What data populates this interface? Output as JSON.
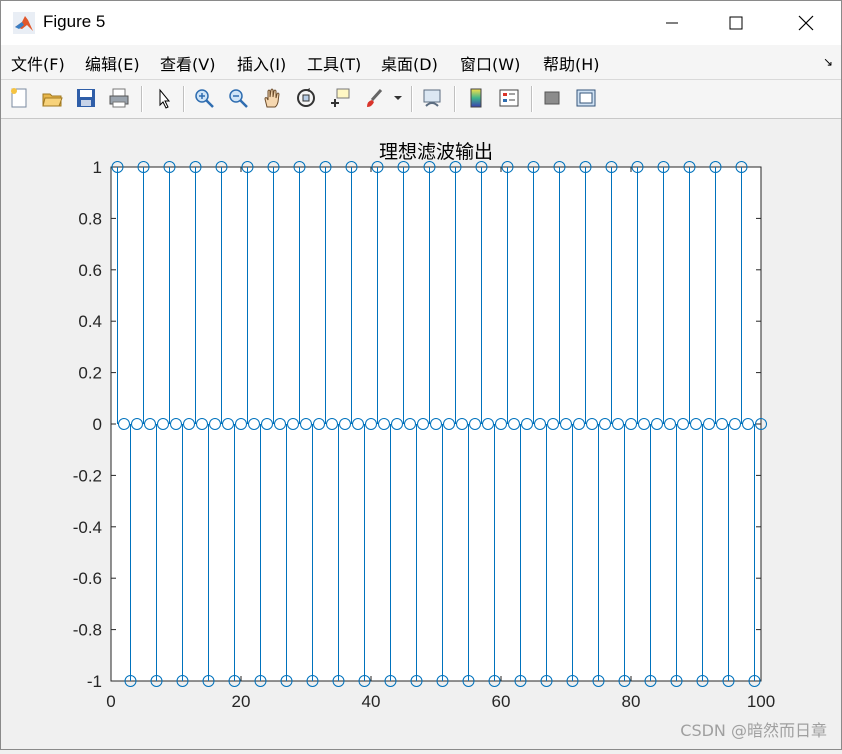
{
  "window": {
    "title": "Figure 5"
  },
  "menu": [
    "文件(F)",
    "编辑(E)",
    "查看(V)",
    "插入(I)",
    "工具(T)",
    "桌面(D)",
    "窗口(W)",
    "帮助(H)"
  ],
  "toolbar": [
    "new-figure-icon",
    "open-file-icon",
    "save-icon",
    "print-icon",
    "pointer-icon",
    "zoom-in-icon",
    "zoom-out-icon",
    "pan-hand-icon",
    "rotate-3d-icon",
    "data-cursor-icon",
    "brush-icon",
    "brush-dropdown-icon",
    "link-plot-icon",
    "colorbar-icon",
    "legend-icon",
    "hide-plot-tools-icon",
    "show-plot-tools-icon"
  ],
  "watermark": "CSDN @暗然而日章",
  "chart_data": {
    "type": "stem",
    "title": "理想滤波输出",
    "xlabel": "",
    "ylabel": "",
    "xlim": [
      0,
      100
    ],
    "ylim": [
      -1,
      1
    ],
    "xticks": [
      "0",
      "20",
      "40",
      "60",
      "80",
      "100"
    ],
    "yticks": [
      "-1",
      "-0.8",
      "-0.6",
      "-0.4",
      "-0.2",
      "0",
      "0.2",
      "0.4",
      "0.6",
      "0.8",
      "1"
    ],
    "color": "#0072bd",
    "x": [
      1,
      2,
      3,
      4,
      5,
      6,
      7,
      8,
      9,
      10,
      11,
      12,
      13,
      14,
      15,
      16,
      17,
      18,
      19,
      20,
      21,
      22,
      23,
      24,
      25,
      26,
      27,
      28,
      29,
      30,
      31,
      32,
      33,
      34,
      35,
      36,
      37,
      38,
      39,
      40,
      41,
      42,
      43,
      44,
      45,
      46,
      47,
      48,
      49,
      50,
      51,
      52,
      53,
      54,
      55,
      56,
      57,
      58,
      59,
      60,
      61,
      62,
      63,
      64,
      65,
      66,
      67,
      68,
      69,
      70,
      71,
      72,
      73,
      74,
      75,
      76,
      77,
      78,
      79,
      80,
      81,
      82,
      83,
      84,
      85,
      86,
      87,
      88,
      89,
      90,
      91,
      92,
      93,
      94,
      95,
      96,
      97,
      98,
      99,
      100
    ],
    "values": [
      1,
      0,
      -1,
      0,
      1,
      0,
      -1,
      0,
      1,
      0,
      -1,
      0,
      1,
      0,
      -1,
      0,
      1,
      0,
      -1,
      0,
      1,
      0,
      -1,
      0,
      1,
      0,
      -1,
      0,
      1,
      0,
      -1,
      0,
      1,
      0,
      -1,
      0,
      1,
      0,
      -1,
      0,
      1,
      0,
      -1,
      0,
      1,
      0,
      -1,
      0,
      1,
      0,
      -1,
      0,
      1,
      0,
      -1,
      0,
      1,
      0,
      -1,
      0,
      1,
      0,
      -1,
      0,
      1,
      0,
      -1,
      0,
      1,
      0,
      -1,
      0,
      1,
      0,
      -1,
      0,
      1,
      0,
      -1,
      0,
      1,
      0,
      -1,
      0,
      1,
      0,
      -1,
      0,
      1,
      0,
      -1,
      0,
      1,
      0,
      -1,
      0,
      1,
      0,
      -1,
      0
    ]
  }
}
